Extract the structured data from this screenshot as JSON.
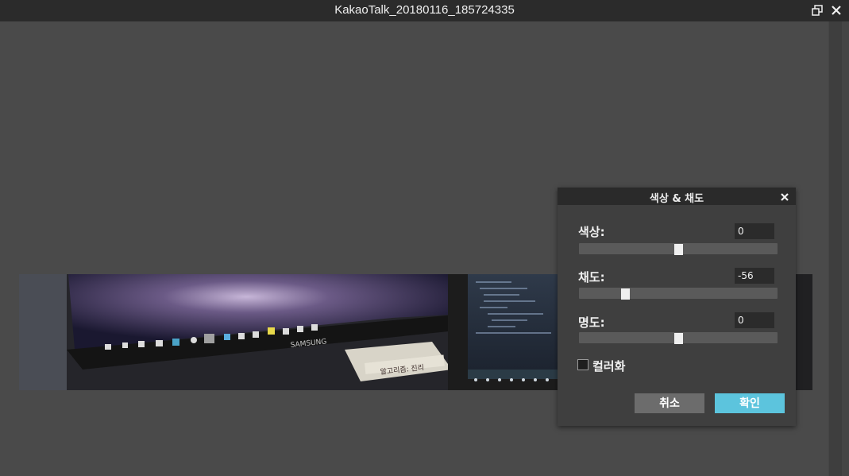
{
  "window": {
    "title": "KakaoTalk_20180116_185724335",
    "restore_icon": "restore-window-icon",
    "close_icon": "close-icon"
  },
  "photo": {
    "monitor_brand": "SAMSUNG",
    "book_text": "알고리즘: 진리",
    "description_icon": "photo"
  },
  "dialog": {
    "title": "색상 & 채도",
    "close_icon": "close-icon",
    "hue": {
      "label": "색상:",
      "value": "0",
      "min": -180,
      "max": 180,
      "level": 0
    },
    "saturation": {
      "label": "채도:",
      "value": "-56",
      "min": -100,
      "max": 100,
      "level": -56
    },
    "brightness": {
      "label": "명도:",
      "value": "0",
      "min": -100,
      "max": 100,
      "level": 0
    },
    "colorize": {
      "label": "컬러화",
      "checked": false
    },
    "cancel_label": "취소",
    "ok_label": "확인",
    "colors": {
      "ok": "#5cc4dd",
      "cancel": "#6c6c6c"
    }
  }
}
